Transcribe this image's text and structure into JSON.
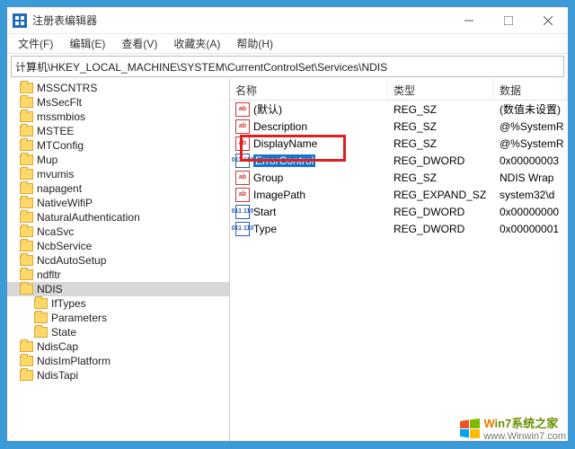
{
  "window": {
    "title": "注册表编辑器"
  },
  "menu": {
    "file": "文件(F)",
    "edit": "编辑(E)",
    "view": "查看(V)",
    "favorites": "收藏夹(A)",
    "help": "帮助(H)"
  },
  "address": "计算机\\HKEY_LOCAL_MACHINE\\SYSTEM\\CurrentControlSet\\Services\\NDIS",
  "tree": [
    {
      "label": "MSSCNTRS",
      "indent": 0
    },
    {
      "label": "MsSecFlt",
      "indent": 0
    },
    {
      "label": "mssmbios",
      "indent": 0
    },
    {
      "label": "MSTEE",
      "indent": 0
    },
    {
      "label": "MTConfig",
      "indent": 0
    },
    {
      "label": "Mup",
      "indent": 0
    },
    {
      "label": "mvumis",
      "indent": 0
    },
    {
      "label": "napagent",
      "indent": 0
    },
    {
      "label": "NativeWifiP",
      "indent": 0
    },
    {
      "label": "NaturalAuthentication",
      "indent": 0
    },
    {
      "label": "NcaSvc",
      "indent": 0
    },
    {
      "label": "NcbService",
      "indent": 0
    },
    {
      "label": "NcdAutoSetup",
      "indent": 0
    },
    {
      "label": "ndfltr",
      "indent": 0
    },
    {
      "label": "NDIS",
      "indent": 0,
      "selected": true
    },
    {
      "label": "IfTypes",
      "indent": 1
    },
    {
      "label": "Parameters",
      "indent": 1
    },
    {
      "label": "State",
      "indent": 1
    },
    {
      "label": "NdisCap",
      "indent": 0
    },
    {
      "label": "NdisImPlatform",
      "indent": 0
    },
    {
      "label": "NdisTapi",
      "indent": 0
    }
  ],
  "columns": {
    "name": "名称",
    "type": "类型",
    "data": "数据"
  },
  "values": [
    {
      "icon": "str",
      "name": "(默认)",
      "type": "REG_SZ",
      "data": "(数值未设置)"
    },
    {
      "icon": "str",
      "name": "Description",
      "type": "REG_SZ",
      "data": "@%SystemR"
    },
    {
      "icon": "str",
      "name": "DisplayName",
      "type": "REG_SZ",
      "data": "@%SystemR"
    },
    {
      "icon": "bin",
      "name": "ErrorControl",
      "type": "REG_DWORD",
      "data": "0x00000003",
      "selected": true
    },
    {
      "icon": "str",
      "name": "Group",
      "type": "REG_SZ",
      "data": "NDIS Wrap"
    },
    {
      "icon": "str",
      "name": "ImagePath",
      "type": "REG_EXPAND_SZ",
      "data": "system32\\d"
    },
    {
      "icon": "bin",
      "name": "Start",
      "type": "REG_DWORD",
      "data": "0x00000000"
    },
    {
      "icon": "bin",
      "name": "Type",
      "type": "REG_DWORD",
      "data": "0x00000001"
    }
  ],
  "watermark": {
    "brand_w": "W",
    "brand_rest": "in7系统之家",
    "url": "www.Winwin7.com"
  }
}
